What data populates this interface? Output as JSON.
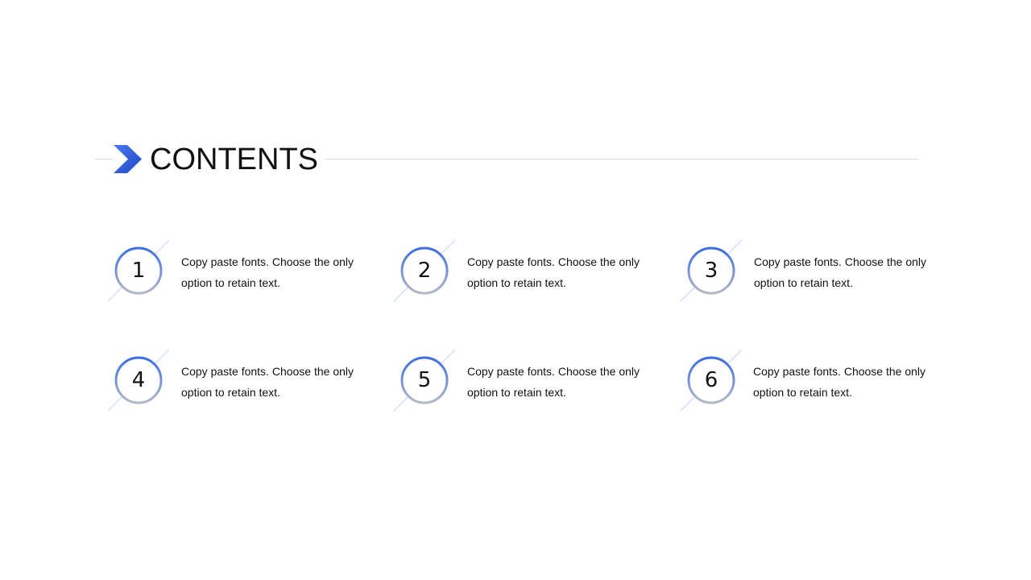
{
  "header": {
    "title": "CONTENTS",
    "accent_color": "#2f5fe0"
  },
  "items": [
    {
      "number": "1",
      "text": "Copy paste fonts. Choose the only option to retain text."
    },
    {
      "number": "2",
      "text": "Copy paste fonts. Choose the only option to retain text."
    },
    {
      "number": "3",
      "text": "Copy paste fonts. Choose the only option to retain text."
    },
    {
      "number": "4",
      "text": "Copy paste fonts. Choose the only option to retain text."
    },
    {
      "number": "5",
      "text": "Copy paste fonts. Choose the only option to retain text."
    },
    {
      "number": "6",
      "text": "Copy paste fonts. Choose the only option to retain text."
    }
  ],
  "colors": {
    "circle_top": "#3c6ee0",
    "circle_bottom": "#b4b8c8",
    "diagonal": "#c7d2f5"
  }
}
